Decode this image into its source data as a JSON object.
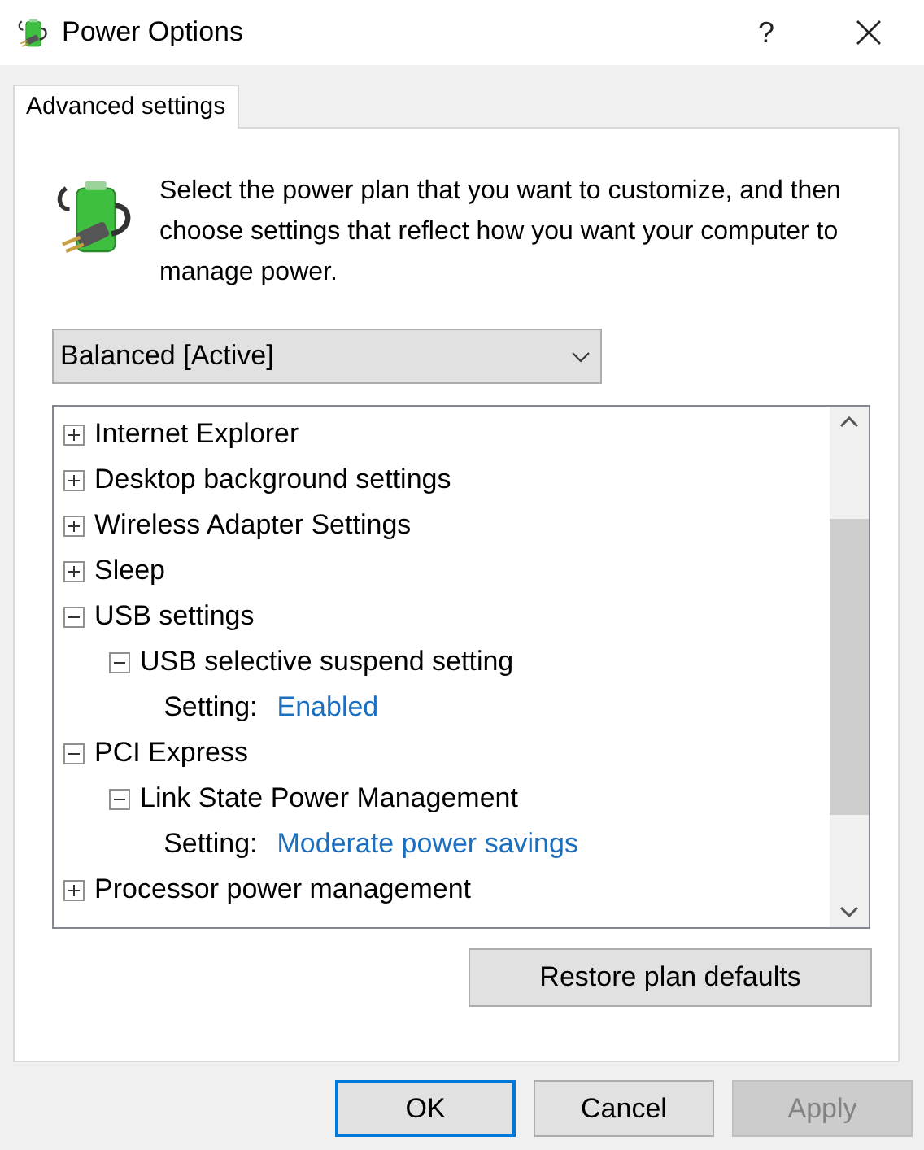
{
  "window": {
    "title": "Power Options",
    "help": "?"
  },
  "tabs": [
    {
      "label": "Advanced settings",
      "selected": true
    }
  ],
  "intro": "Select the power plan that you want to customize, and then choose settings that reflect how you want your computer to manage power.",
  "plan_dropdown": {
    "value": "Balanced [Active]"
  },
  "tree": [
    {
      "kind": "group",
      "label": "Internet Explorer",
      "expanded": false
    },
    {
      "kind": "group",
      "label": "Desktop background settings",
      "expanded": false
    },
    {
      "kind": "group",
      "label": "Wireless Adapter Settings",
      "expanded": false
    },
    {
      "kind": "group",
      "label": "Sleep",
      "expanded": false
    },
    {
      "kind": "group",
      "label": "USB settings",
      "expanded": true,
      "children": [
        {
          "kind": "group",
          "label": "USB selective suspend setting",
          "expanded": true,
          "children": [
            {
              "kind": "setting",
              "label": "Setting:",
              "value": "Enabled"
            }
          ]
        }
      ]
    },
    {
      "kind": "group",
      "label": "PCI Express",
      "expanded": true,
      "children": [
        {
          "kind": "group",
          "label": "Link State Power Management",
          "expanded": true,
          "children": [
            {
              "kind": "setting",
              "label": "Setting:",
              "value": "Moderate power savings"
            }
          ]
        }
      ]
    },
    {
      "kind": "group",
      "label": "Processor power management",
      "expanded": false
    }
  ],
  "restore_button": {
    "label": "Restore plan defaults"
  },
  "buttons": [
    {
      "label": "OK",
      "default": true,
      "disabled": false
    },
    {
      "label": "Cancel",
      "default": false,
      "disabled": false
    },
    {
      "label": "Apply",
      "default": false,
      "disabled": true
    }
  ]
}
